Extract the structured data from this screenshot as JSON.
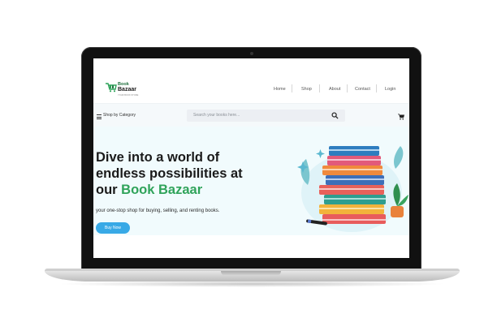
{
  "site": {
    "logo": {
      "line1": "Book",
      "line2": "Bazaar",
      "tagline": "YOUR BOOK STORE"
    },
    "nav": [
      {
        "label": "Home"
      },
      {
        "label": "Shop"
      },
      {
        "label": "About"
      },
      {
        "label": "Contact"
      },
      {
        "label": "Login"
      }
    ],
    "category": {
      "label": "Shop by Category"
    },
    "search": {
      "placeholder": "Search your books here..."
    },
    "hero": {
      "title_part1": "Dive into a world of endless possibilities at our ",
      "title_highlight": "Book Bazaar",
      "subtitle": "your one-stop shop for buying, selling, and renting books.",
      "button": "Buy Now"
    }
  },
  "colors": {
    "brand_green": "#2fa35a",
    "button_blue": "#38a9e6",
    "hero_bg": "#f1fbfd"
  },
  "icons": [
    "cart-logo-icon",
    "hamburger-menu-icon",
    "search-icon",
    "cart-icon",
    "book-stack-illustration"
  ]
}
